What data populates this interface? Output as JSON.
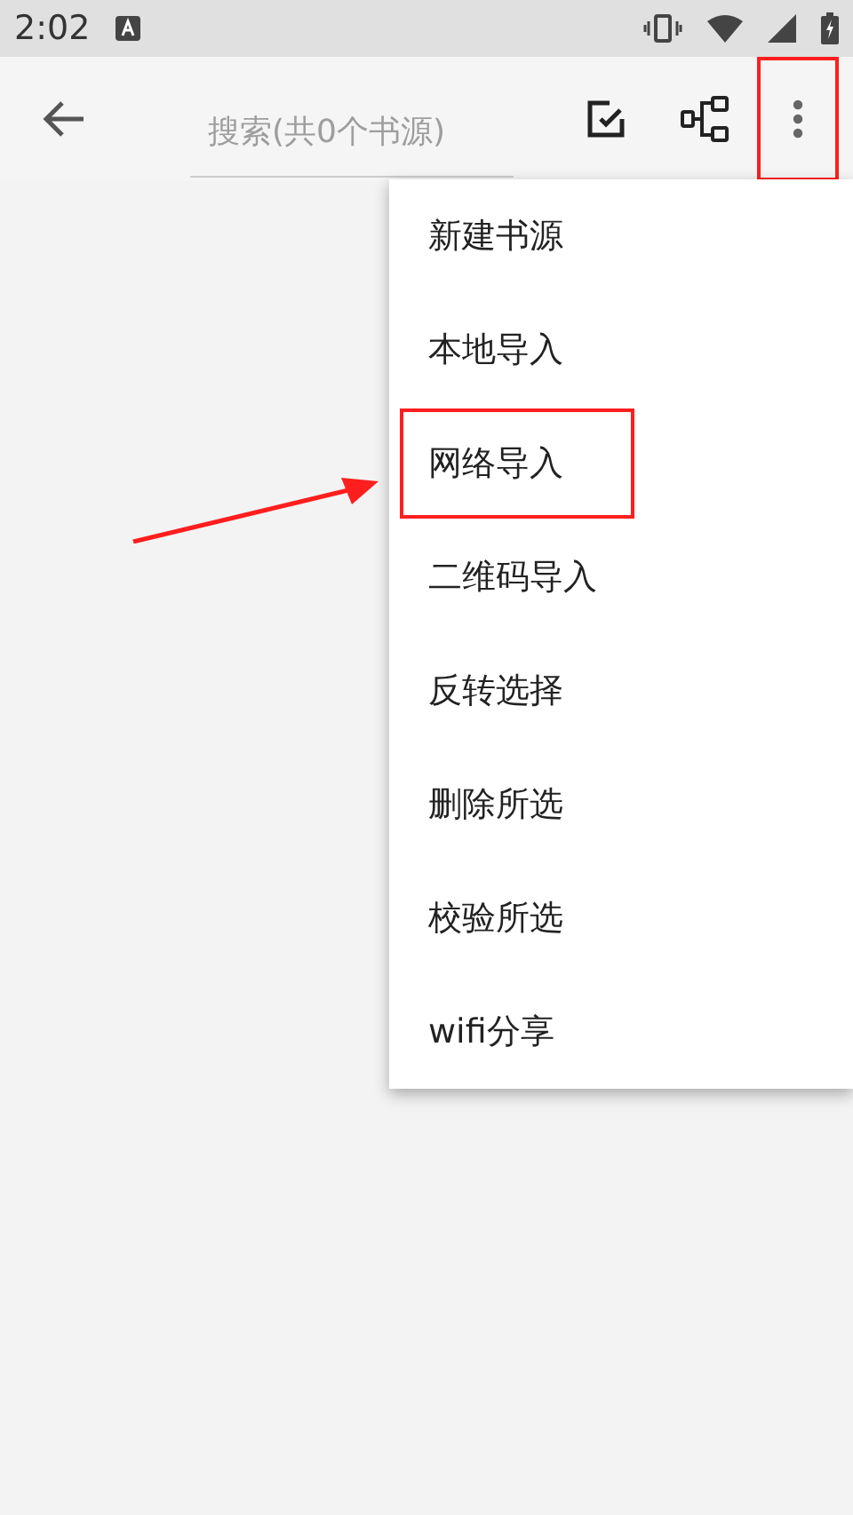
{
  "status_bar": {
    "time": "2:02"
  },
  "toolbar": {
    "search": {
      "placeholder": "搜索(共0个书源)"
    },
    "more_annotated": true
  },
  "menu": {
    "items": [
      {
        "label": "新建书源",
        "annotated": false
      },
      {
        "label": "本地导入",
        "annotated": false
      },
      {
        "label": "网络导入",
        "annotated": true
      },
      {
        "label": "二维码导入",
        "annotated": false
      },
      {
        "label": "反转选择",
        "annotated": false
      },
      {
        "label": "删除所选",
        "annotated": false
      },
      {
        "label": "校验所选",
        "annotated": false
      },
      {
        "label": "wifi分享",
        "annotated": false
      }
    ]
  }
}
